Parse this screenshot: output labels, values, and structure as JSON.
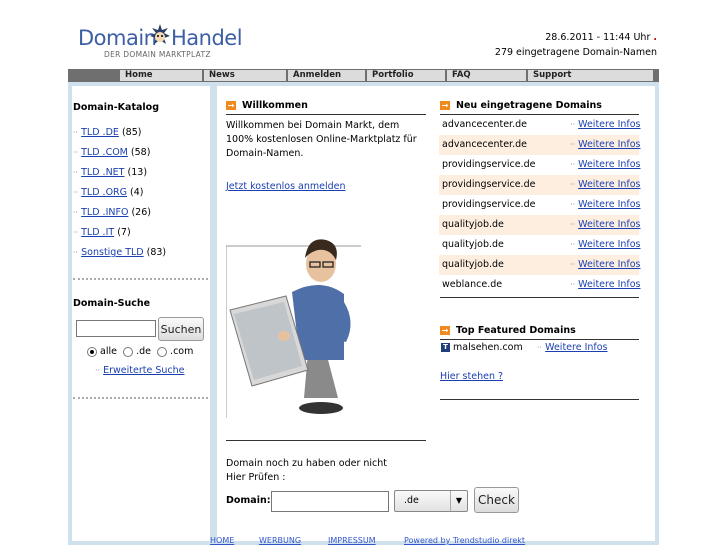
{
  "header": {
    "logo_left": "Domain",
    "logo_right": "Handel",
    "logo_sub": "DER DOMAIN MARKTPLATZ",
    "datetime": "28.6.2011 - 11:44 Uhr",
    "domain_count": "279 eingetragene Domain-Namen"
  },
  "nav": [
    "Home",
    "News",
    "Anmelden",
    "Portfolio",
    "FAQ",
    "Support"
  ],
  "sidebar": {
    "catalog_title": "Domain-Katalog",
    "catalog": [
      {
        "label": "TLD .DE",
        "count": "(85)"
      },
      {
        "label": "TLD .COM",
        "count": "(58)"
      },
      {
        "label": "TLD .NET",
        "count": "(13)"
      },
      {
        "label": "TLD .ORG",
        "count": "(4)"
      },
      {
        "label": "TLD .INFO",
        "count": "(26)"
      },
      {
        "label": "TLD .IT",
        "count": "(7)"
      },
      {
        "label": "Sonstige TLD",
        "count": "(83)"
      }
    ],
    "search_title": "Domain-Suche",
    "search_button": "Suchen",
    "radio_all": "alle",
    "radio_de": ".de",
    "radio_com": ".com",
    "advanced_search": "Erweiterte Suche"
  },
  "welcome": {
    "title": "Willkommen",
    "text": "Willkommen bei Domain Markt, dem 100% kostenlosen Online-Marktplatz für Domain-Namen.",
    "register_link": "Jetzt kostenlos anmelden"
  },
  "check": {
    "text": "Domain noch zu haben oder nicht Hier Prüfen :",
    "label": "Domain:",
    "tld_value": ".de",
    "button": "Check"
  },
  "new_domains": {
    "title": "Neu eingetragene Domains",
    "more_label": "Weitere Infos",
    "items": [
      "advancecenter.de",
      "advancecenter.de",
      "providingservice.de",
      "providingservice.de",
      "providingservice.de",
      "qualityjob.de",
      "qualityjob.de",
      "qualityjob.de",
      "weblance.de"
    ]
  },
  "featured": {
    "title": "Top Featured Domains",
    "domain": "malsehen.com",
    "more_label": "Weitere Infos",
    "stand_here": "Hier stehen ?"
  },
  "footer": [
    "HOME",
    "WERBUNG",
    "IMPRESSUM",
    "Powered by Trendstudio direkt"
  ],
  "colors": {
    "accent": "#f08a1c",
    "link": "#1a3fb0",
    "frame": "#cfe1ec",
    "row_alt": "#fdeee0"
  }
}
